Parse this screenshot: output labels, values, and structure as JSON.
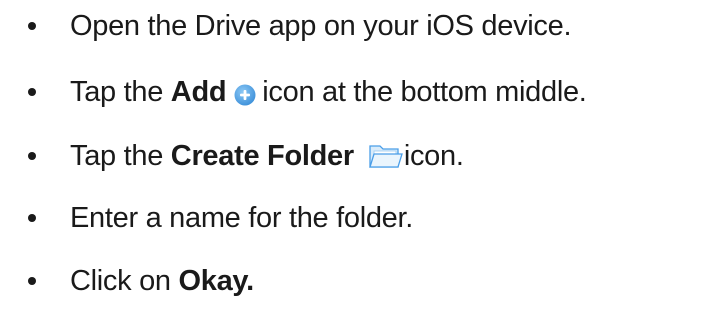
{
  "steps": [
    {
      "before": "Open the Drive app on your iOS device."
    },
    {
      "before": "Tap the ",
      "bold": "Add",
      "icon": "add-circle-icon",
      "after": "icon at the bottom middle."
    },
    {
      "before": "Tap the ",
      "bold": "Create Folder",
      "icon": "folder-icon",
      "after": "icon."
    },
    {
      "before": "Enter a name for the folder."
    },
    {
      "before": "Click on ",
      "bold": "Okay."
    }
  ],
  "colors": {
    "text": "#1a1a1a",
    "add_icon": "#4a9ee8",
    "folder_icon": "#5fa8e8"
  }
}
